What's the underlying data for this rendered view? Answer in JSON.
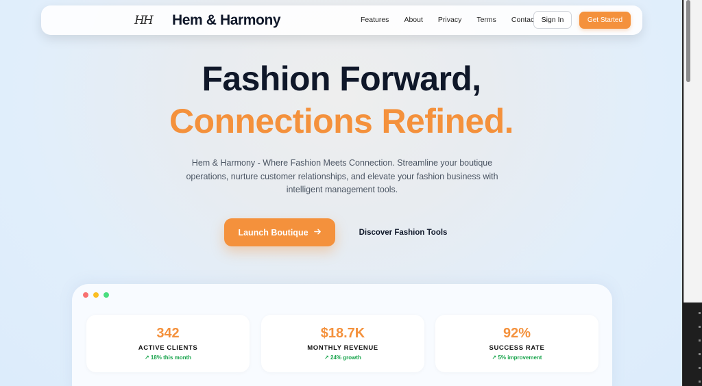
{
  "brand": {
    "logo_mark": "HH",
    "name": "Hem & Harmony"
  },
  "nav": {
    "links": [
      "Features",
      "About",
      "Privacy",
      "Terms",
      "Contact"
    ],
    "sign_in": "Sign In",
    "get_started": "Get Started"
  },
  "hero": {
    "headline_line1": "Fashion Forward,",
    "headline_line2": "Connections Refined.",
    "description": "Hem & Harmony - Where Fashion Meets Connection. Streamline your boutique operations, nurture customer relationships, and elevate your fashion business with intelligent management tools.",
    "primary_cta": "Launch Boutique",
    "primary_cta_icon": "arrow-right-icon",
    "secondary_cta": "Discover Fashion Tools"
  },
  "dashboard": {
    "window_dots": [
      "#f87171",
      "#fbbf24",
      "#4ade80"
    ],
    "stats": [
      {
        "value": "342",
        "label": "ACTIVE CLIENTS",
        "trend": "↗ 18% this month"
      },
      {
        "value": "$18.7K",
        "label": "MONTHLY REVENUE",
        "trend": "↗ 24% growth"
      },
      {
        "value": "92%",
        "label": "SUCCESS RATE",
        "trend": "↗ 5% improvement"
      }
    ]
  },
  "colors": {
    "accent": "#f4913c",
    "heading": "#0f1729",
    "success": "#16a34a"
  }
}
